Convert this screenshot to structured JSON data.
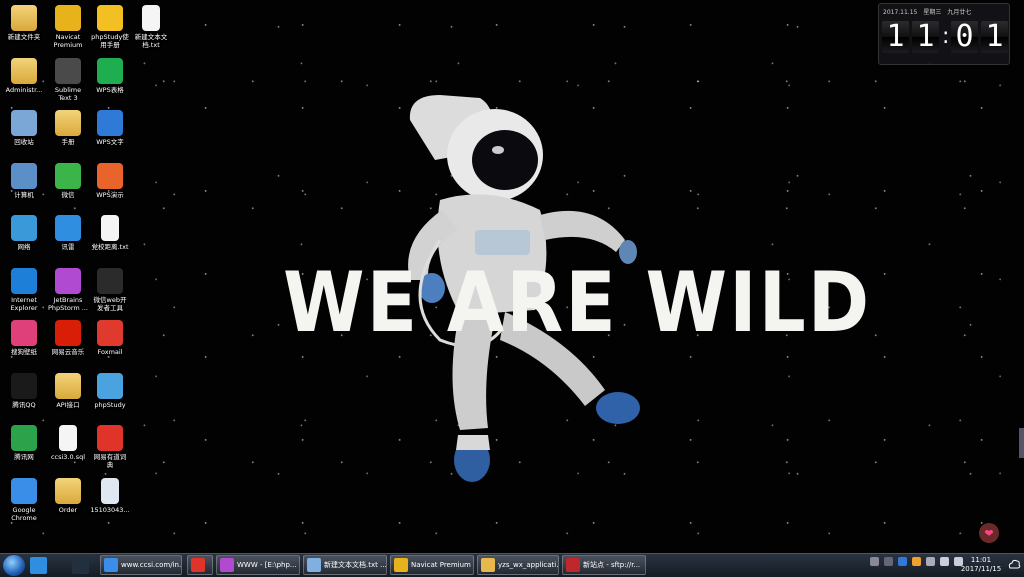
{
  "desktop": {
    "hero_text": "WE ARE WILD",
    "icons": [
      {
        "label": "新建文件夹",
        "icon": "folder-icon",
        "color": "#e8b84a"
      },
      {
        "label": "Navicat\nPremium",
        "icon": "navicat-icon",
        "color": "#e7b21c"
      },
      {
        "label": "phpStudy使\n用手册",
        "icon": "help-icon",
        "color": "#f2c022"
      },
      {
        "label": "新建文本文\n档.txt",
        "icon": "text-file-icon",
        "color": "#f5f5f5"
      },
      {
        "label": "Administr...",
        "icon": "user-folder-icon",
        "color": "#e8b84a"
      },
      {
        "label": "Sublime\nText 3",
        "icon": "sublime-icon",
        "color": "#4a4a4a"
      },
      {
        "label": "WPS表格",
        "icon": "wps-sheet-icon",
        "color": "#1fae4f"
      },
      {
        "label": "回收站",
        "icon": "recycle-bin-icon",
        "color": "#7aa7d6"
      },
      {
        "label": "手册",
        "icon": "folder-icon",
        "color": "#e8b84a"
      },
      {
        "label": "WPS文字",
        "icon": "wps-writer-icon",
        "color": "#2f7ad6"
      },
      {
        "label": "计算机",
        "icon": "computer-icon",
        "color": "#5b8fc7"
      },
      {
        "label": "微信",
        "icon": "wechat-icon",
        "color": "#3bb54a"
      },
      {
        "label": "WPS演示",
        "icon": "wps-presentation-icon",
        "color": "#e8642a"
      },
      {
        "label": "网络",
        "icon": "network-icon",
        "color": "#3a9ad9"
      },
      {
        "label": "讯雷",
        "icon": "thunder-icon",
        "color": "#2f8ee0"
      },
      {
        "label": "党校距离.txt",
        "icon": "text-file-icon",
        "color": "#f5f5f5"
      },
      {
        "label": "Internet\nExplorer",
        "icon": "ie-icon",
        "color": "#1e7fd8"
      },
      {
        "label": "JetBrains\nPhpStorm ...",
        "icon": "phpstorm-icon",
        "color": "#b04ad0"
      },
      {
        "label": "微信web开\n发者工具",
        "icon": "wechat-devtools-icon",
        "color": "#2b2b2b"
      },
      {
        "label": "搜狗壁纸",
        "icon": "sogou-wallpaper-icon",
        "color": "#e0407a"
      },
      {
        "label": "网易云音乐",
        "icon": "netease-music-icon",
        "color": "#d81e06"
      },
      {
        "label": "Foxmail",
        "icon": "foxmail-icon",
        "color": "#e03a2f"
      },
      {
        "label": "腾讯QQ",
        "icon": "qq-icon",
        "color": "#1a1a1a"
      },
      {
        "label": "API接口",
        "icon": "folder-icon",
        "color": "#e8b84a"
      },
      {
        "label": "phpStudy",
        "icon": "phpstudy-icon",
        "color": "#4aa3df"
      },
      {
        "label": "腾讯网",
        "icon": "tencent-news-icon",
        "color": "#2ca24a"
      },
      {
        "label": "ccsi3.0.sql",
        "icon": "sql-file-icon",
        "color": "#f5f5f5"
      },
      {
        "label": "网易有道词\n典",
        "icon": "youdao-icon",
        "color": "#e0342a"
      },
      {
        "label": "Google\nChrome",
        "icon": "chrome-icon",
        "color": "#3b8ee8"
      },
      {
        "label": "Order",
        "icon": "folder-icon",
        "color": "#e8b84a"
      },
      {
        "label": "15103043...",
        "icon": "image-file-icon",
        "color": "#dfe8f2"
      }
    ]
  },
  "clock_widget": {
    "date": "2017.11.15　星期三　九月廿七",
    "h1": "1",
    "h2": "1",
    "m1": "0",
    "m2": "1"
  },
  "taskbar": {
    "quick_launch": [
      {
        "name": "thunder-quick-icon",
        "color": "#2f8ee0"
      },
      {
        "name": "terminal-quick-icon",
        "color": "#222f3f"
      }
    ],
    "tasks": [
      {
        "label": "www.ccsi.com/in...",
        "icon": "chrome-icon",
        "color": "#3b8ee8"
      },
      {
        "label": "",
        "icon": "youdao-icon",
        "color": "#e0342a"
      },
      {
        "label": "WWW - [E:\\php...",
        "icon": "phpstorm-icon",
        "color": "#b04ad0"
      },
      {
        "label": "新建文本文档.txt ...",
        "icon": "notepad-icon",
        "color": "#7fb0e0"
      },
      {
        "label": "Navicat Premium",
        "icon": "navicat-icon",
        "color": "#e7b21c"
      },
      {
        "label": "yzs_wx_applicati...",
        "icon": "folder-icon",
        "color": "#e8b84a"
      },
      {
        "label": "新站点 - sftp://r...",
        "icon": "filezilla-icon",
        "color": "#c0272d"
      }
    ],
    "clock_time": "11:01",
    "clock_date": "2017/11/15"
  }
}
